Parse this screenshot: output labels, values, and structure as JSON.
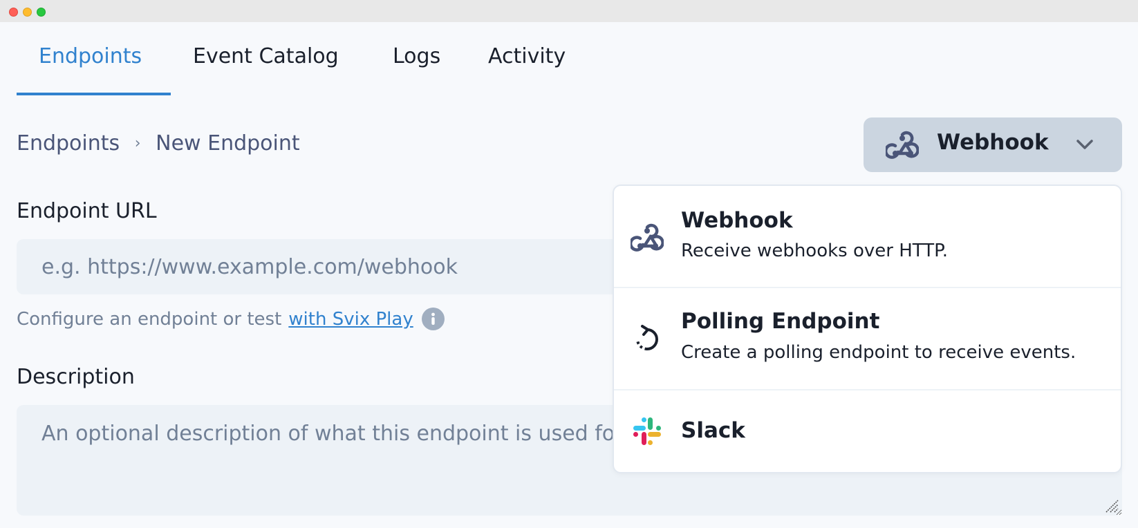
{
  "window": {
    "controls": [
      "close",
      "minimize",
      "maximize"
    ]
  },
  "tabs": [
    {
      "label": "Endpoints",
      "active": true
    },
    {
      "label": "Event Catalog",
      "active": false
    },
    {
      "label": "Logs",
      "active": false
    },
    {
      "label": "Activity",
      "active": false
    }
  ],
  "breadcrumb": {
    "items": [
      "Endpoints",
      "New Endpoint"
    ],
    "separator": "›"
  },
  "type_selector": {
    "selected": "Webhook",
    "icon": "webhook-icon",
    "expanded": true,
    "options": [
      {
        "title": "Webhook",
        "description": "Receive webhooks over HTTP.",
        "icon": "webhook-icon"
      },
      {
        "title": "Polling Endpoint",
        "description": "Create a polling endpoint to receive events.",
        "icon": "polling-icon"
      },
      {
        "title": "Slack",
        "description": "",
        "icon": "slack-icon"
      }
    ]
  },
  "form": {
    "url": {
      "label": "Endpoint URL",
      "value": "",
      "placeholder": "e.g. https://www.example.com/webhook",
      "helper_text": "Configure an endpoint or test",
      "helper_link": "with Svix Play"
    },
    "description": {
      "label": "Description",
      "value": "",
      "placeholder": "An optional description of what this endpoint is used for."
    }
  },
  "colors": {
    "accent": "#3182ce",
    "button_bg": "#cbd5e0",
    "input_bg": "#edf2f7",
    "page_bg": "#f7f9fc",
    "slack_blue": "#36c5f0",
    "slack_green": "#2eb67d",
    "slack_red": "#e01e5a",
    "slack_yellow": "#ecb22e"
  }
}
